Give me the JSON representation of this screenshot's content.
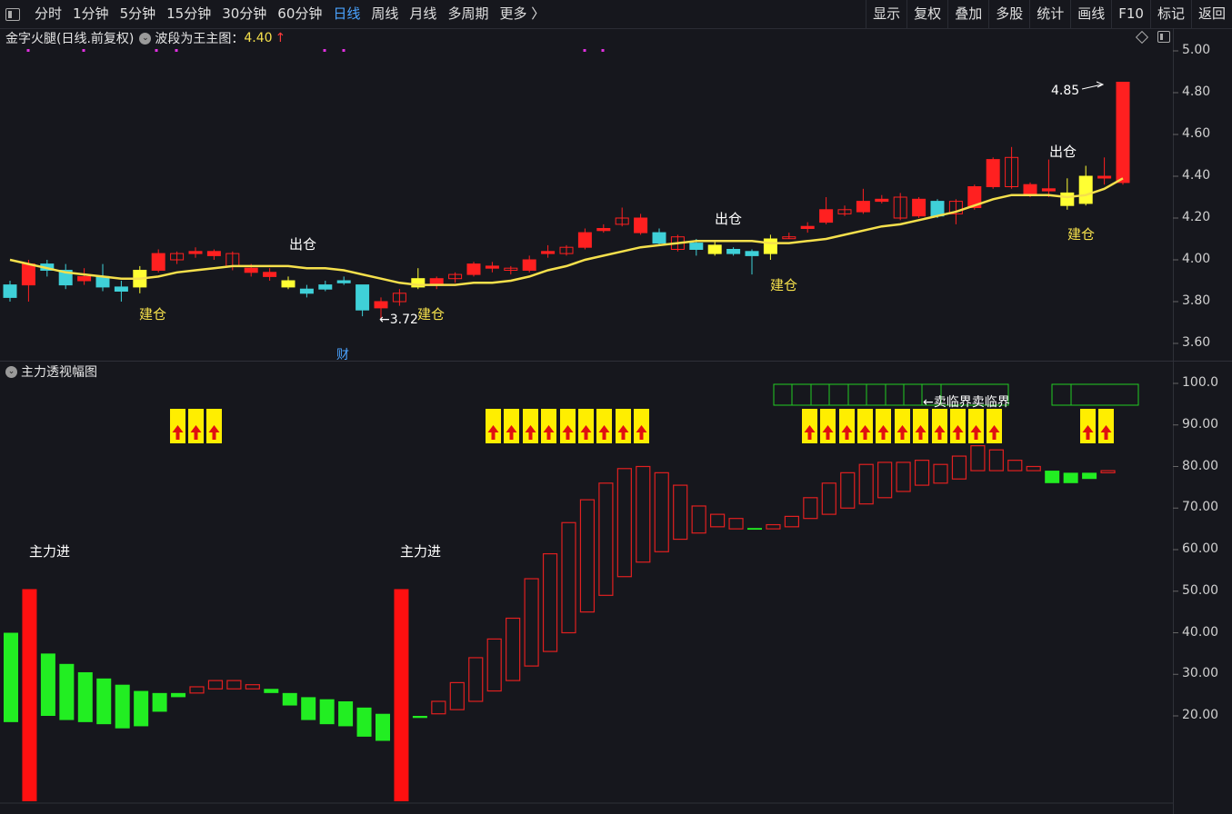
{
  "toolbar": {
    "periods": [
      "分时",
      "1分钟",
      "5分钟",
      "15分钟",
      "30分钟",
      "60分钟",
      "日线",
      "周线",
      "月线",
      "多周期",
      "更多 〉"
    ],
    "active_period": "日线",
    "actions": [
      "显示",
      "复权",
      "叠加",
      "多股",
      "统计",
      "画线",
      "F10",
      "标记",
      "返回"
    ]
  },
  "main_chart": {
    "stock_label": "金字火腿(日线.前复权)",
    "indicator_label": "波段为王主图：",
    "indicator_value": "4.40",
    "up_arrow": "↑",
    "high_label": "4.85",
    "low_label": "←3.72",
    "finance_marker": "财",
    "buy_label": "建仓",
    "sell_label": "出仓",
    "y_ticks": [
      "5.00",
      "4.80",
      "4.60",
      "4.40",
      "4.20",
      "4.00",
      "3.80",
      "3.60"
    ],
    "colors": {
      "up": "#ff2020",
      "down": "#3fd0d8",
      "ma": "#f5e04c",
      "signal_box": "#ffff33",
      "dots": "#e030e0"
    }
  },
  "sub_chart": {
    "title": "主力透视幅图",
    "main_in_label": "主力进",
    "sell_critical_label": "←卖临界卖临界",
    "y_ticks": [
      "100.0",
      "90.00",
      "80.00",
      "70.00",
      "60.00",
      "50.00",
      "40.00",
      "30.00",
      "20.00"
    ],
    "colors": {
      "up_outline": "#e02020",
      "down_fill": "#22ee22",
      "spike": "#ff1010",
      "yellow_sig": "#ffee00"
    }
  },
  "chart_data": [
    {
      "type": "candlestick",
      "title": "金字火腿(日线.前复权)",
      "ylim": [
        3.55,
        5.0
      ],
      "note_high": "4.85",
      "note_low": "3.72",
      "candles": [
        {
          "o": 3.82,
          "c": 3.88,
          "h": 3.9,
          "l": 3.8,
          "d": "dn"
        },
        {
          "o": 3.88,
          "c": 3.98,
          "h": 4.0,
          "l": 3.8,
          "d": "up"
        },
        {
          "o": 3.98,
          "c": 3.95,
          "h": 4.0,
          "l": 3.92,
          "d": "dn"
        },
        {
          "o": 3.95,
          "c": 3.88,
          "h": 3.98,
          "l": 3.86,
          "d": "dn"
        },
        {
          "o": 3.9,
          "c": 3.92,
          "h": 3.96,
          "l": 3.88,
          "d": "up"
        },
        {
          "o": 3.92,
          "c": 3.87,
          "h": 3.98,
          "l": 3.85,
          "d": "dn"
        },
        {
          "o": 3.87,
          "c": 3.85,
          "h": 3.9,
          "l": 3.8,
          "d": "dn"
        },
        {
          "o": 3.87,
          "c": 3.95,
          "h": 3.97,
          "l": 3.84,
          "sig": "buy"
        },
        {
          "o": 3.95,
          "c": 4.03,
          "h": 4.05,
          "l": 3.94,
          "d": "up"
        },
        {
          "o": 4.0,
          "c": 4.03,
          "h": 4.04,
          "l": 3.98,
          "d": "up"
        },
        {
          "o": 4.03,
          "c": 4.04,
          "h": 4.06,
          "l": 4.01,
          "d": "up"
        },
        {
          "o": 4.04,
          "c": 4.02,
          "h": 4.05,
          "l": 4.0,
          "d": "up"
        },
        {
          "o": 4.03,
          "c": 3.97,
          "h": 4.04,
          "l": 3.95,
          "d": "up"
        },
        {
          "o": 3.96,
          "c": 3.94,
          "h": 3.98,
          "l": 3.92,
          "d": "up"
        },
        {
          "o": 3.94,
          "c": 3.92,
          "h": 3.96,
          "l": 3.9,
          "d": "up"
        },
        {
          "o": 3.9,
          "c": 3.87,
          "h": 3.92,
          "l": 3.86,
          "sig": "sell"
        },
        {
          "o": 3.86,
          "c": 3.84,
          "h": 3.88,
          "l": 3.82,
          "d": "dn"
        },
        {
          "o": 3.86,
          "c": 3.88,
          "h": 3.9,
          "l": 3.85,
          "d": "dn"
        },
        {
          "o": 3.89,
          "c": 3.9,
          "h": 3.92,
          "l": 3.88,
          "d": "dn"
        },
        {
          "o": 3.88,
          "c": 3.76,
          "h": 3.88,
          "l": 3.73,
          "d": "dn"
        },
        {
          "o": 3.8,
          "c": 3.77,
          "h": 3.82,
          "l": 3.72,
          "d": "up"
        },
        {
          "o": 3.8,
          "c": 3.84,
          "h": 3.86,
          "l": 3.78,
          "d": "up"
        },
        {
          "o": 3.87,
          "c": 3.91,
          "h": 3.96,
          "l": 3.86,
          "sig": "buy"
        },
        {
          "o": 3.88,
          "c": 3.91,
          "h": 3.92,
          "l": 3.86,
          "d": "up"
        },
        {
          "o": 3.91,
          "c": 3.93,
          "h": 3.94,
          "l": 3.89,
          "d": "up"
        },
        {
          "o": 3.93,
          "c": 3.98,
          "h": 3.99,
          "l": 3.92,
          "d": "up"
        },
        {
          "o": 3.96,
          "c": 3.97,
          "h": 3.99,
          "l": 3.94,
          "d": "up"
        },
        {
          "o": 3.95,
          "c": 3.96,
          "h": 3.97,
          "l": 3.93,
          "d": "up"
        },
        {
          "o": 3.95,
          "c": 4.0,
          "h": 4.02,
          "l": 3.94,
          "d": "up"
        },
        {
          "o": 4.03,
          "c": 4.04,
          "h": 4.07,
          "l": 4.01,
          "d": "up"
        },
        {
          "o": 4.03,
          "c": 4.06,
          "h": 4.07,
          "l": 4.02,
          "d": "up"
        },
        {
          "o": 4.06,
          "c": 4.13,
          "h": 4.15,
          "l": 4.05,
          "d": "up"
        },
        {
          "o": 4.14,
          "c": 4.15,
          "h": 4.17,
          "l": 4.13,
          "d": "up"
        },
        {
          "o": 4.17,
          "c": 4.2,
          "h": 4.25,
          "l": 4.16,
          "d": "up"
        },
        {
          "o": 4.2,
          "c": 4.13,
          "h": 4.22,
          "l": 4.12,
          "d": "up"
        },
        {
          "o": 4.13,
          "c": 4.08,
          "h": 4.15,
          "l": 4.07,
          "d": "dn"
        },
        {
          "o": 4.11,
          "c": 4.05,
          "h": 4.12,
          "l": 4.04,
          "d": "up"
        },
        {
          "o": 4.05,
          "c": 4.08,
          "h": 4.1,
          "l": 4.02,
          "d": "dn"
        },
        {
          "o": 4.03,
          "c": 4.07,
          "h": 4.09,
          "l": 4.02,
          "sig": "sell"
        },
        {
          "o": 4.05,
          "c": 4.03,
          "h": 4.06,
          "l": 4.02,
          "d": "dn"
        },
        {
          "o": 4.04,
          "c": 4.02,
          "h": 4.05,
          "l": 3.93,
          "d": "dn"
        },
        {
          "o": 4.03,
          "c": 4.1,
          "h": 4.12,
          "l": 4.0,
          "sig": "buy"
        },
        {
          "o": 4.11,
          "c": 4.11,
          "h": 4.13,
          "l": 4.1,
          "d": "up"
        },
        {
          "o": 4.15,
          "c": 4.16,
          "h": 4.18,
          "l": 4.13,
          "d": "up"
        },
        {
          "o": 4.18,
          "c": 4.24,
          "h": 4.3,
          "l": 4.17,
          "d": "up"
        },
        {
          "o": 4.22,
          "c": 4.24,
          "h": 4.26,
          "l": 4.21,
          "d": "up"
        },
        {
          "o": 4.23,
          "c": 4.28,
          "h": 4.34,
          "l": 4.22,
          "d": "up"
        },
        {
          "o": 4.28,
          "c": 4.29,
          "h": 4.31,
          "l": 4.27,
          "d": "up"
        },
        {
          "o": 4.3,
          "c": 4.2,
          "h": 4.32,
          "l": 4.19,
          "d": "up"
        },
        {
          "o": 4.29,
          "c": 4.21,
          "h": 4.3,
          "l": 4.2,
          "d": "up"
        },
        {
          "o": 4.28,
          "c": 4.21,
          "h": 4.29,
          "l": 4.2,
          "d": "dn"
        },
        {
          "o": 4.22,
          "c": 4.28,
          "h": 4.29,
          "l": 4.17,
          "d": "up"
        },
        {
          "o": 4.25,
          "c": 4.35,
          "h": 4.36,
          "l": 4.24,
          "d": "up"
        },
        {
          "o": 4.35,
          "c": 4.48,
          "h": 4.49,
          "l": 4.34,
          "d": "up"
        },
        {
          "o": 4.49,
          "c": 4.35,
          "h": 4.54,
          "l": 4.34,
          "d": "up"
        },
        {
          "o": 4.36,
          "c": 4.31,
          "h": 4.37,
          "l": 4.3,
          "d": "up"
        },
        {
          "o": 4.33,
          "c": 4.34,
          "h": 4.48,
          "l": 4.3,
          "d": "up"
        },
        {
          "o": 4.26,
          "c": 4.32,
          "h": 4.39,
          "l": 4.24,
          "sig": "buy"
        },
        {
          "o": 4.27,
          "c": 4.4,
          "h": 4.45,
          "l": 4.26,
          "sig": "buy"
        },
        {
          "o": 4.4,
          "c": 4.4,
          "h": 4.49,
          "l": 4.36,
          "d": "up"
        },
        {
          "o": 4.37,
          "c": 4.85,
          "h": 4.85,
          "l": 4.36,
          "d": "up"
        }
      ]
    },
    {
      "type": "bar",
      "title": "主力透视幅图",
      "ylim": [
        0,
        100
      ],
      "bars": [
        {
          "lo": 18.5,
          "hi": 40,
          "k": "g"
        },
        {
          "lo": 0,
          "hi": 50.5,
          "k": "spike"
        },
        {
          "lo": 20,
          "hi": 35,
          "k": "g"
        },
        {
          "lo": 19,
          "hi": 32.5,
          "k": "g"
        },
        {
          "lo": 18.5,
          "hi": 30.5,
          "k": "g"
        },
        {
          "lo": 18,
          "hi": 29,
          "k": "g"
        },
        {
          "lo": 17,
          "hi": 27.5,
          "k": "g"
        },
        {
          "lo": 17.5,
          "hi": 26,
          "k": "g"
        },
        {
          "lo": 21,
          "hi": 25.5,
          "k": "g"
        },
        {
          "lo": 24.5,
          "hi": 25.5,
          "k": "g"
        },
        {
          "lo": 25.5,
          "hi": 27,
          "k": "r"
        },
        {
          "lo": 26.5,
          "hi": 28.5,
          "k": "r"
        },
        {
          "lo": 26.5,
          "hi": 28.5,
          "k": "r"
        },
        {
          "lo": 26.5,
          "hi": 27.5,
          "k": "r"
        },
        {
          "lo": 25.5,
          "hi": 26.5,
          "k": "g"
        },
        {
          "lo": 22.5,
          "hi": 25.5,
          "k": "g"
        },
        {
          "lo": 19,
          "hi": 24.5,
          "k": "g"
        },
        {
          "lo": 18,
          "hi": 24,
          "k": "g"
        },
        {
          "lo": 17.5,
          "hi": 23.5,
          "k": "g"
        },
        {
          "lo": 15,
          "hi": 22,
          "k": "g"
        },
        {
          "lo": 14,
          "hi": 20.5,
          "k": "g"
        },
        {
          "lo": 0,
          "hi": 50.5,
          "k": "spike"
        },
        {
          "lo": 19.5,
          "hi": 20,
          "k": "g"
        },
        {
          "lo": 20.5,
          "hi": 23.5,
          "k": "r"
        },
        {
          "lo": 21.5,
          "hi": 28,
          "k": "r"
        },
        {
          "lo": 23.5,
          "hi": 34,
          "k": "r"
        },
        {
          "lo": 26,
          "hi": 38.5,
          "k": "r"
        },
        {
          "lo": 28.5,
          "hi": 43.5,
          "k": "r"
        },
        {
          "lo": 32,
          "hi": 53,
          "k": "r"
        },
        {
          "lo": 35.5,
          "hi": 59,
          "k": "r"
        },
        {
          "lo": 40,
          "hi": 66.5,
          "k": "r"
        },
        {
          "lo": 45,
          "hi": 72,
          "k": "r"
        },
        {
          "lo": 49,
          "hi": 76,
          "k": "r"
        },
        {
          "lo": 53.5,
          "hi": 79.5,
          "k": "r"
        },
        {
          "lo": 57,
          "hi": 80,
          "k": "r"
        },
        {
          "lo": 59.5,
          "hi": 78.5,
          "k": "r"
        },
        {
          "lo": 62.5,
          "hi": 75.5,
          "k": "r"
        },
        {
          "lo": 64,
          "hi": 70.5,
          "k": "r"
        },
        {
          "lo": 65.5,
          "hi": 68.5,
          "k": "r"
        },
        {
          "lo": 65,
          "hi": 67.5,
          "k": "r"
        },
        {
          "lo": 64.8,
          "hi": 65.2,
          "k": "g"
        },
        {
          "lo": 65,
          "hi": 66,
          "k": "r"
        },
        {
          "lo": 65.5,
          "hi": 68,
          "k": "r"
        },
        {
          "lo": 67.5,
          "hi": 72.5,
          "k": "r"
        },
        {
          "lo": 68.5,
          "hi": 76,
          "k": "r"
        },
        {
          "lo": 70,
          "hi": 78.5,
          "k": "r"
        },
        {
          "lo": 71,
          "hi": 80.5,
          "k": "r"
        },
        {
          "lo": 72.5,
          "hi": 81,
          "k": "r"
        },
        {
          "lo": 74,
          "hi": 81,
          "k": "r"
        },
        {
          "lo": 75.5,
          "hi": 81.5,
          "k": "r"
        },
        {
          "lo": 76,
          "hi": 80.5,
          "k": "r"
        },
        {
          "lo": 77,
          "hi": 82.5,
          "k": "r"
        },
        {
          "lo": 79,
          "hi": 85,
          "k": "r"
        },
        {
          "lo": 79,
          "hi": 84,
          "k": "r"
        },
        {
          "lo": 79,
          "hi": 81.5,
          "k": "r"
        },
        {
          "lo": 79,
          "hi": 80,
          "k": "r"
        },
        {
          "lo": 76,
          "hi": 79,
          "k": "g"
        },
        {
          "lo": 76,
          "hi": 78.5,
          "k": "g"
        },
        {
          "lo": 77,
          "hi": 78.5,
          "k": "g"
        },
        {
          "lo": 78.5,
          "hi": 79,
          "k": "r"
        }
      ]
    }
  ]
}
